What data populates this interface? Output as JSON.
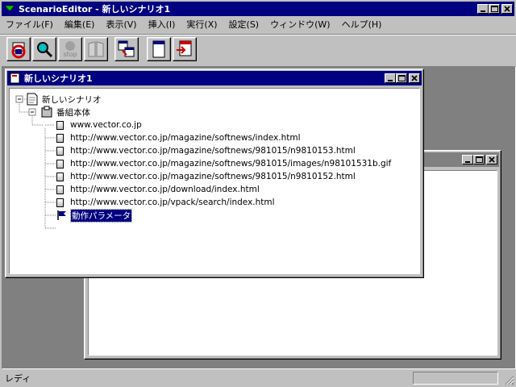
{
  "app": {
    "title": "ScenarioEditor - 新しいシナリオ1"
  },
  "menu": [
    "ファイル(F)",
    "編集(E)",
    "表示(V)",
    "挿入(I)",
    "実行(X)",
    "設定(S)",
    "ウィンドウ(W)",
    "ヘルプ(H)"
  ],
  "toolbar": {
    "stop_label": "stop"
  },
  "child_window": {
    "title": "新しいシナリオ1"
  },
  "tree": {
    "root": "新しいシナリオ",
    "group": "番組本体",
    "items": [
      "www.vector.co.jp",
      "http://www.vector.co.jp/magazine/softnews/index.html",
      "http://www.vector.co.jp/magazine/softnews/981015/n9810153.html",
      "http://www.vector.co.jp/magazine/softnews/981015/images/n98101531b.gif",
      "http://www.vector.co.jp/magazine/softnews/981015/n9810152.html",
      "http://www.vector.co.jp/download/index.html",
      "http://www.vector.co.jp/vpack/search/index.html"
    ],
    "selected": "動作パラメータ"
  },
  "status": {
    "text": "レディ"
  },
  "colors": {
    "active_title": "#000080",
    "inactive_title": "#808080",
    "face": "#c0c0c0"
  }
}
